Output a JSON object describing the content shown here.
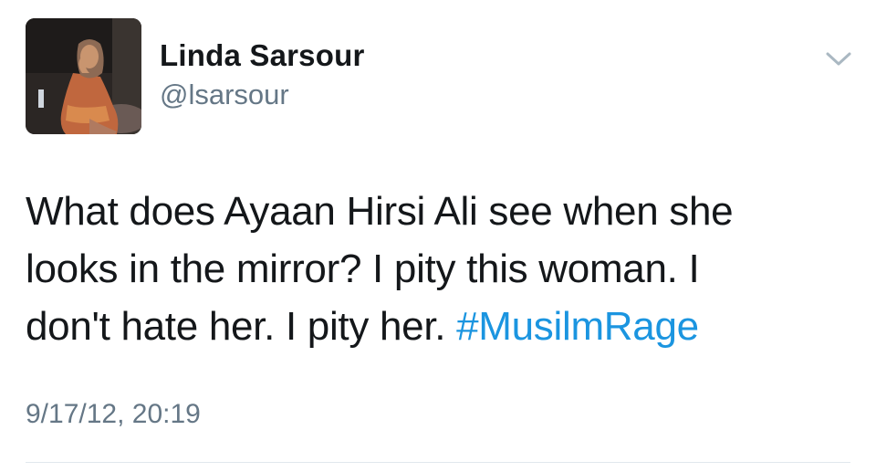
{
  "author": {
    "display_name": "Linda Sarsour",
    "handle": "@lsarsour",
    "avatar_icon": "profile-photo"
  },
  "menu": {
    "icon": "chevron-down-icon"
  },
  "tweet": {
    "lines": [
      "What does Ayaan Hirsi Ali see when she",
      "looks in the mirror? I pity this woman. I",
      "don't hate her. I pity her. "
    ],
    "hashtag": "#MusilmRage",
    "timestamp": "9/17/12, 20:19"
  },
  "colors": {
    "text": "#14171a",
    "secondary": "#657786",
    "link": "#1b95e0",
    "divider": "#e1e8ed"
  }
}
